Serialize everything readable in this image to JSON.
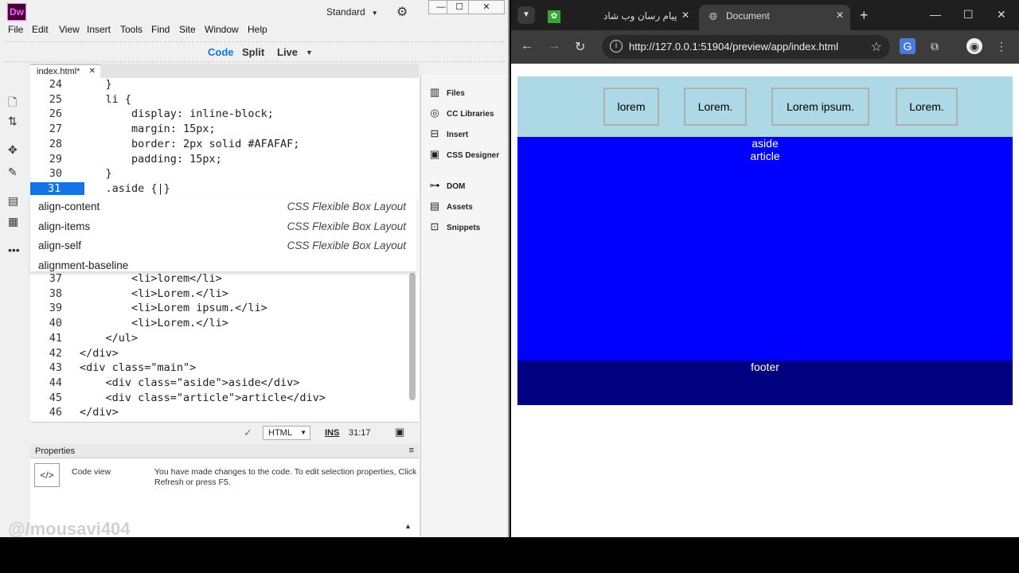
{
  "dw": {
    "logo": "Dw",
    "workspace": "Standard",
    "window_controls": [
      "—",
      "☐",
      "✕"
    ],
    "menu": [
      "File",
      "Edit",
      "View",
      "Insert",
      "Tools",
      "Find",
      "Site",
      "Window",
      "Help"
    ],
    "view_modes": [
      "Code",
      "Split",
      "Live"
    ],
    "tab_name": "index.html*",
    "code_lines": [
      {
        "num": "24",
        "text": "    }"
      },
      {
        "num": "25",
        "text": "    li {"
      },
      {
        "num": "26",
        "text": "        display: inline-block;"
      },
      {
        "num": "27",
        "text": "        margin: 15px;"
      },
      {
        "num": "28",
        "text": "        border: 2px solid #AFAFAF;"
      },
      {
        "num": "29",
        "text": "        padding: 15px;"
      },
      {
        "num": "30",
        "text": "    }"
      },
      {
        "num": "31",
        "text": "    .aside {|}"
      }
    ],
    "code_lines_after": [
      {
        "num": "37",
        "text": "        <li>lorem</li>"
      },
      {
        "num": "38",
        "text": "        <li>Lorem.</li>"
      },
      {
        "num": "39",
        "text": "        <li>Lorem ipsum.</li>"
      },
      {
        "num": "40",
        "text": "        <li>Lorem.</li>"
      },
      {
        "num": "41",
        "text": "    </ul>"
      },
      {
        "num": "42",
        "text": "</div>"
      },
      {
        "num": "43",
        "text": "<div class=\"main\">"
      },
      {
        "num": "44",
        "text": "    <div class=\"aside\">aside</div>"
      },
      {
        "num": "45",
        "text": "    <div class=\"article\">article</div>"
      },
      {
        "num": "46",
        "text": "</div>"
      }
    ],
    "autocomplete": [
      {
        "name": "align-content",
        "category": "CSS Flexible Box Layout"
      },
      {
        "name": "align-items",
        "category": "CSS Flexible Box Layout"
      },
      {
        "name": "align-self",
        "category": "CSS Flexible Box Layout"
      },
      {
        "name": "alignment-baseline",
        "category": ""
      }
    ],
    "status": {
      "language": "HTML",
      "mode": "INS",
      "position": "31:17"
    },
    "properties": {
      "title": "Properties",
      "mode": "Code view",
      "message": "You have made changes to the code. To edit selection properties, Click Refresh or press F5."
    },
    "right_panel": [
      "Files",
      "CC Libraries",
      "Insert",
      "CSS Designer",
      "DOM",
      "Assets",
      "Snippets"
    ],
    "watermark": "@/mousavi404"
  },
  "chrome": {
    "tab_inactive_title": "پیام رسان وب شاد",
    "tab_active_title": "Document",
    "url": "http://127.0.0.1:51904/preview/app/index.html",
    "page": {
      "nav_items": [
        "lorem",
        "Lorem.",
        "Lorem ipsum.",
        "Lorem."
      ],
      "aside": "aside",
      "article": "article",
      "footer": "footer",
      "colors": {
        "header": "#add8e6",
        "main": "#0000ff",
        "footer": "#000080"
      }
    }
  }
}
